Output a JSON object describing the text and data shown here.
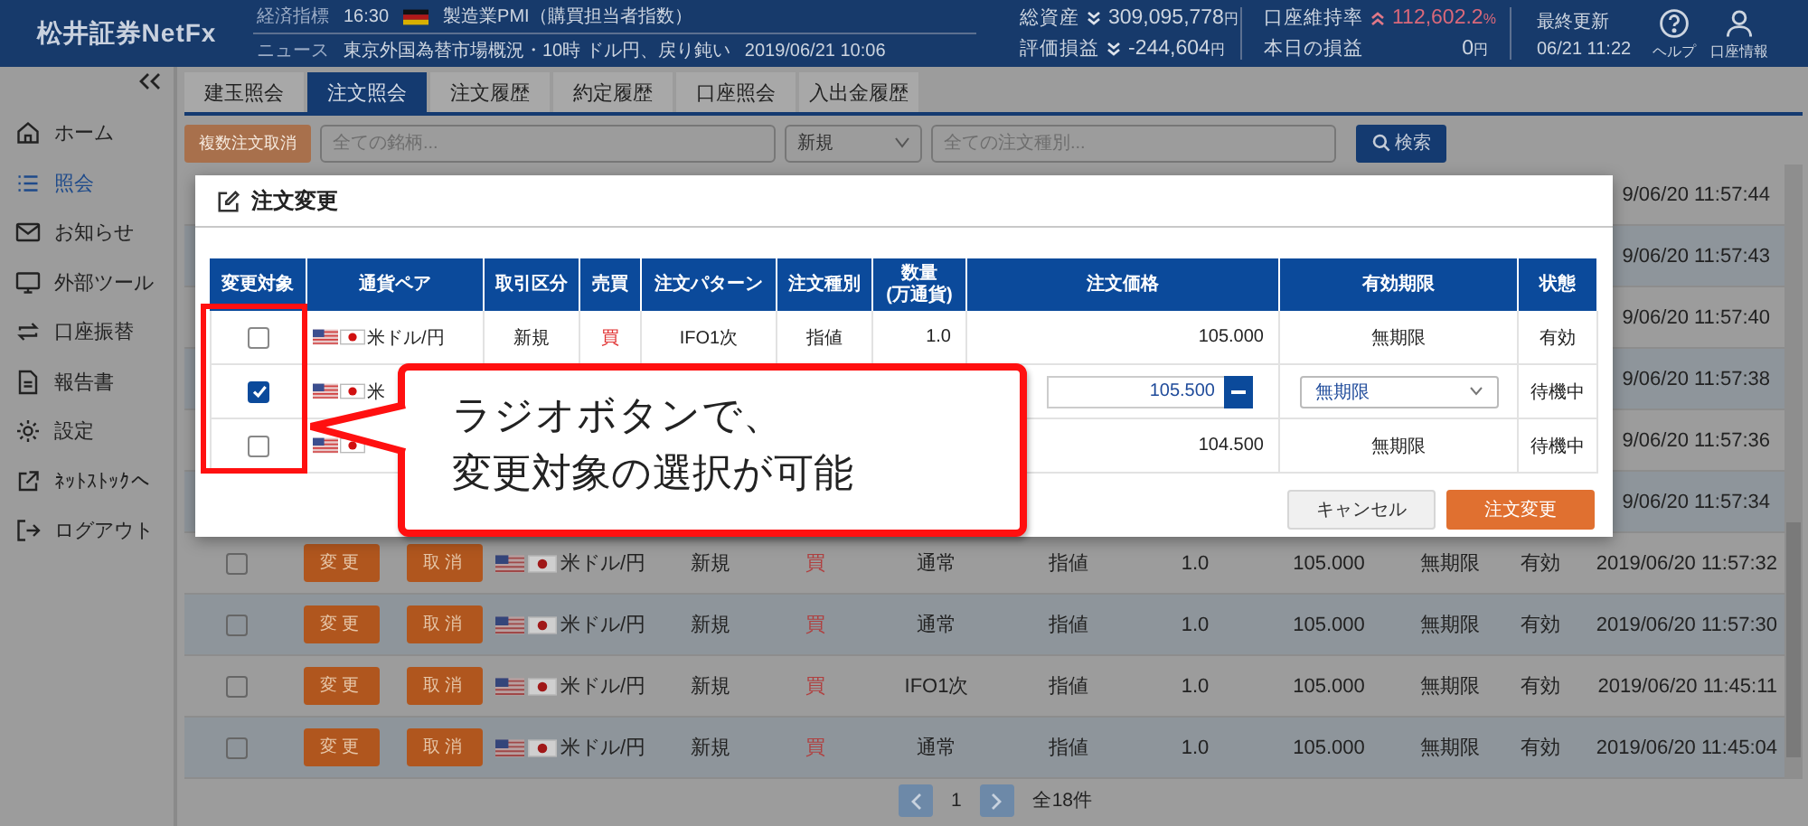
{
  "header": {
    "logo": "松井証券NetFx",
    "ticker": [
      {
        "kind": "indicator",
        "label": "経済指標",
        "time": "16:30",
        "text": "製造業PMI（購買担当者指数）"
      },
      {
        "kind": "news",
        "label": "ニュース",
        "text": "東京外国為替市場概況・10時 ドル円、戻り鈍い",
        "time": "2019/06/21 10:06"
      }
    ],
    "stat_groups": [
      {
        "items": [
          {
            "label": "総資産",
            "kind": "falling",
            "value": "309,095,778",
            "unit": "円"
          },
          {
            "label": "評価損益",
            "kind": "falling",
            "value": "-244,604",
            "unit": "円"
          }
        ]
      },
      {
        "items": [
          {
            "label": "口座維持率",
            "kind": "rising",
            "value": "112,602.2",
            "unit": "%"
          },
          {
            "label": "本日の損益",
            "kind": "plain",
            "value": "0",
            "unit": "円"
          }
        ]
      }
    ],
    "last_update": {
      "label": "最終更新",
      "value": "06/21 11:22"
    },
    "actions": [
      {
        "kind": "help",
        "label": "ヘルプ"
      },
      {
        "kind": "account",
        "label": "口座情報"
      }
    ]
  },
  "sidebar": {
    "items": [
      {
        "kind": "home",
        "label": "ホーム",
        "selected": false
      },
      {
        "kind": "list",
        "label": "照会",
        "selected": true
      },
      {
        "kind": "mail",
        "label": "お知らせ",
        "selected": false
      },
      {
        "kind": "monitor",
        "label": "外部ツール",
        "selected": false
      },
      {
        "kind": "transfer",
        "label": "口座振替",
        "selected": false
      },
      {
        "kind": "document",
        "label": "報告書",
        "selected": false
      },
      {
        "kind": "gear",
        "label": "設定",
        "selected": false
      },
      {
        "kind": "external",
        "label": "ﾈｯﾄｽﾄｯｸへ",
        "selected": false
      },
      {
        "kind": "logout",
        "label": "ログアウト",
        "selected": false
      }
    ]
  },
  "tabs": [
    {
      "label": "建玉照会",
      "selected": false
    },
    {
      "label": "注文照会",
      "selected": true
    },
    {
      "label": "注文履歴",
      "selected": false
    },
    {
      "label": "約定履歴",
      "selected": false
    },
    {
      "label": "口座照会",
      "selected": false
    },
    {
      "label": "入出金履歴",
      "selected": false
    }
  ],
  "filters": {
    "bulk_cancel": {
      "label": "複数注文取消",
      "disabled": true
    },
    "symbol": {
      "placeholder": "全ての銘柄..."
    },
    "trade": {
      "value": "新規"
    },
    "order_type": {
      "placeholder": "全ての注文種別..."
    },
    "search": {
      "label": "検索"
    }
  },
  "orders": {
    "rows": [
      {
        "kind": "covered",
        "time": "9/06/20 11:57:44"
      },
      {
        "kind": "covered",
        "time": "9/06/20 11:57:43"
      },
      {
        "kind": "covered",
        "time": "9/06/20 11:57:40"
      },
      {
        "kind": "covered",
        "time": "9/06/20 11:57:38"
      },
      {
        "kind": "covered",
        "time": "9/06/20 11:57:36"
      },
      {
        "kind": "covered",
        "time": "9/06/20 11:57:34"
      },
      {
        "kind": "full",
        "checked": false,
        "change": "変更",
        "cancel": "取消",
        "pair": "米ドル/円",
        "trade": "新規",
        "side": "買",
        "pattern": "通常",
        "type": "指値",
        "qty": "1.0",
        "price": "105.000",
        "expiry": "無期限",
        "status": "有効",
        "time": "2019/06/20 11:57:32"
      },
      {
        "kind": "full",
        "checked": false,
        "change": "変更",
        "cancel": "取消",
        "pair": "米ドル/円",
        "trade": "新規",
        "side": "買",
        "pattern": "通常",
        "type": "指値",
        "qty": "1.0",
        "price": "105.000",
        "expiry": "無期限",
        "status": "有効",
        "time": "2019/06/20 11:57:30"
      },
      {
        "kind": "full",
        "checked": false,
        "change": "変更",
        "cancel": "取消",
        "pair": "米ドル/円",
        "trade": "新規",
        "side": "買",
        "pattern": "IFO1次",
        "type": "指値",
        "qty": "1.0",
        "price": "105.000",
        "expiry": "無期限",
        "status": "有効",
        "time": "2019/06/20 11:45:11"
      },
      {
        "kind": "full",
        "checked": false,
        "change": "変更",
        "cancel": "取消",
        "pair": "米ドル/円",
        "trade": "新規",
        "side": "買",
        "pattern": "通常",
        "type": "指値",
        "qty": "1.0",
        "price": "105.000",
        "expiry": "無期限",
        "status": "有効",
        "time": "2019/06/20 11:45:04"
      }
    ]
  },
  "pagination": {
    "page": "1",
    "total": "全18件"
  },
  "modal": {
    "title": "注文変更",
    "columns": [
      "変更対象",
      "通貨ペア",
      "取引区分",
      "売買",
      "注文パターン",
      "注文種別",
      "数量\n(万通貨)",
      "注文価格",
      "有効期限",
      "状態"
    ],
    "rows": [
      {
        "kind": "view",
        "selected": false,
        "pair": "米ドル/円",
        "trade": "新規",
        "side": "買",
        "pattern": "IFO1次",
        "type": "指値",
        "qty": "1.0",
        "price": "105.000",
        "expiry": "無期限",
        "status": "有効"
      },
      {
        "kind": "edit",
        "selected": true,
        "pair": "米",
        "price": "105.500",
        "expiry": "無期限",
        "status": "待機中"
      },
      {
        "kind": "view",
        "selected": false,
        "price": "104.500",
        "expiry": "無期限",
        "status": "待機中"
      }
    ],
    "buttons": [
      {
        "kind": "secondary",
        "label": "キャンセル"
      },
      {
        "kind": "primary",
        "label": "注文変更"
      }
    ]
  },
  "callout": {
    "lines": [
      "ラジオボタンで、",
      "変更対象の選択が可能"
    ]
  }
}
